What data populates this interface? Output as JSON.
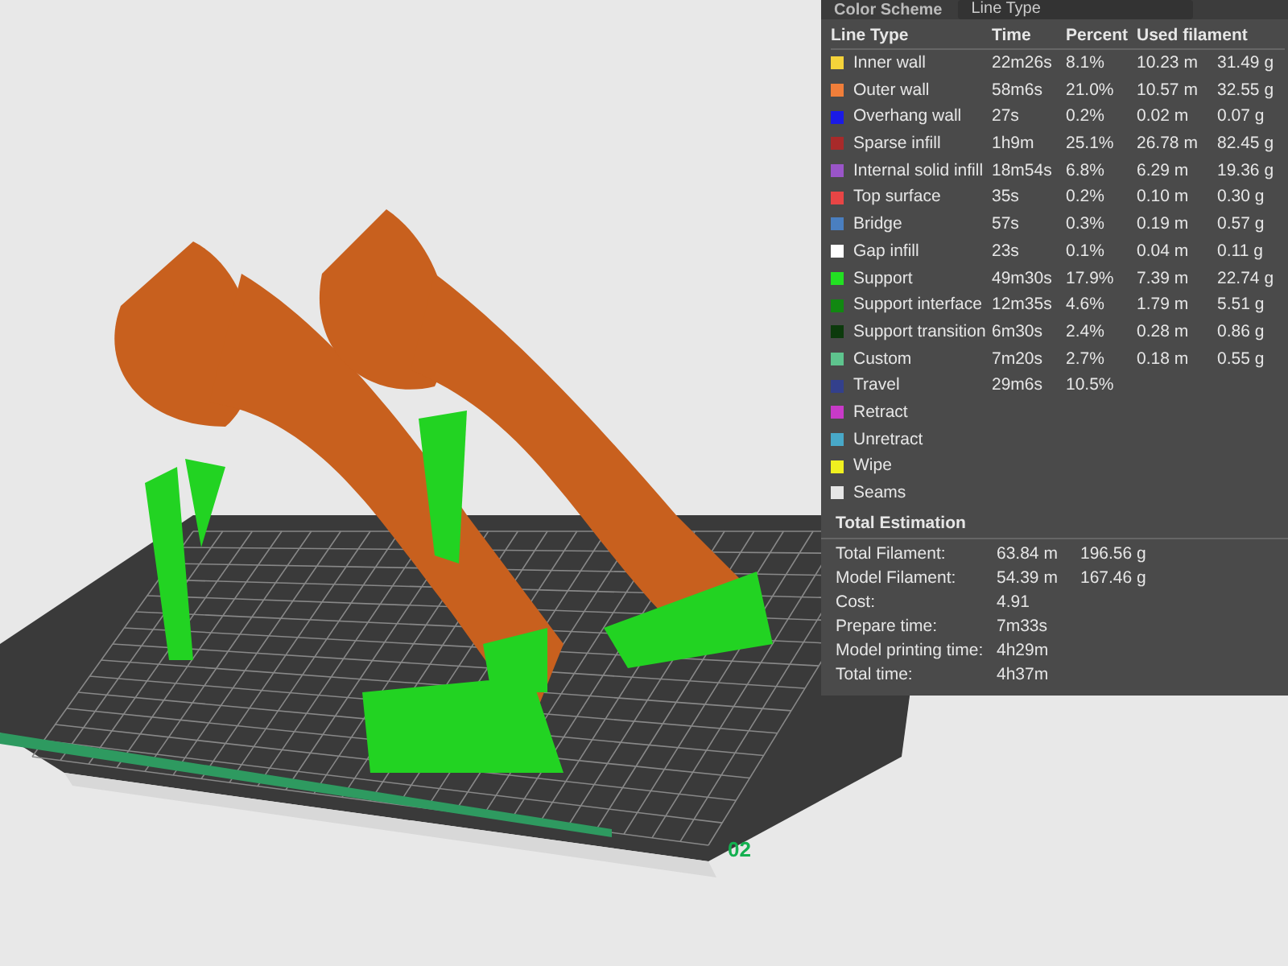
{
  "viewport": {
    "plate_label": "02"
  },
  "color_scheme": {
    "label": "Color Scheme",
    "dropdown": "Line Type"
  },
  "legend": {
    "columns": [
      "Line Type",
      "Time",
      "Percent",
      "Used filament"
    ],
    "rows": [
      {
        "name": "Inner wall",
        "color": "#f5d33a",
        "time": "22m26s",
        "percent": "8.1%",
        "length": "10.23 m",
        "weight": "31.49 g"
      },
      {
        "name": "Outer wall",
        "color": "#f07e3a",
        "time": "58m6s",
        "percent": "21.0%",
        "length": "10.57 m",
        "weight": "32.55 g"
      },
      {
        "name": "Overhang wall",
        "color": "#1a1ae6",
        "time": "27s",
        "percent": "0.2%",
        "length": "0.02 m",
        "weight": "0.07 g"
      },
      {
        "name": "Sparse infill",
        "color": "#a82a2a",
        "time": "1h9m",
        "percent": "25.1%",
        "length": "26.78 m",
        "weight": "82.45 g"
      },
      {
        "name": "Internal solid infill",
        "color": "#9a55c8",
        "time": "18m54s",
        "percent": "6.8%",
        "length": "6.29 m",
        "weight": "19.36 g"
      },
      {
        "name": "Top surface",
        "color": "#e84545",
        "time": "35s",
        "percent": "0.2%",
        "length": "0.10 m",
        "weight": "0.30 g"
      },
      {
        "name": "Bridge",
        "color": "#4a7fc0",
        "time": "57s",
        "percent": "0.3%",
        "length": "0.19 m",
        "weight": "0.57 g"
      },
      {
        "name": "Gap infill",
        "color": "#ffffff",
        "time": "23s",
        "percent": "0.1%",
        "length": "0.04 m",
        "weight": "0.11 g"
      },
      {
        "name": "Support",
        "color": "#22e022",
        "time": "49m30s",
        "percent": "17.9%",
        "length": "7.39 m",
        "weight": "22.74 g"
      },
      {
        "name": "Support interface",
        "color": "#118811",
        "time": "12m35s",
        "percent": "4.6%",
        "length": "1.79 m",
        "weight": "5.51 g"
      },
      {
        "name": "Support transition",
        "color": "#0c3a0c",
        "time": "6m30s",
        "percent": "2.4%",
        "length": "0.28 m",
        "weight": "0.86 g"
      },
      {
        "name": "Custom",
        "color": "#5ec48e",
        "time": "7m20s",
        "percent": "2.7%",
        "length": "0.18 m",
        "weight": "0.55 g"
      },
      {
        "name": "Travel",
        "color": "#33408c",
        "time": "29m6s",
        "percent": "10.5%"
      },
      {
        "name": "Retract",
        "color": "#c83ac8"
      },
      {
        "name": "Unretract",
        "color": "#48a8c8"
      },
      {
        "name": "Wipe",
        "color": "#f0f020"
      },
      {
        "name": "Seams",
        "color": "#e6e6e6"
      }
    ]
  },
  "total_estimation": {
    "title": "Total Estimation",
    "rows": [
      {
        "label": "Total Filament:",
        "value": "63.84 m",
        "value_2": "196.56 g"
      },
      {
        "label": "Model Filament:",
        "value": "54.39 m",
        "value_2": "167.46 g"
      },
      {
        "label": "Cost:",
        "value": "4.91"
      },
      {
        "label": "Prepare time:",
        "value": "7m33s"
      },
      {
        "label": "Model printing time:",
        "value": "4h29m"
      },
      {
        "label": "Total time:",
        "value": "4h37m"
      }
    ]
  }
}
